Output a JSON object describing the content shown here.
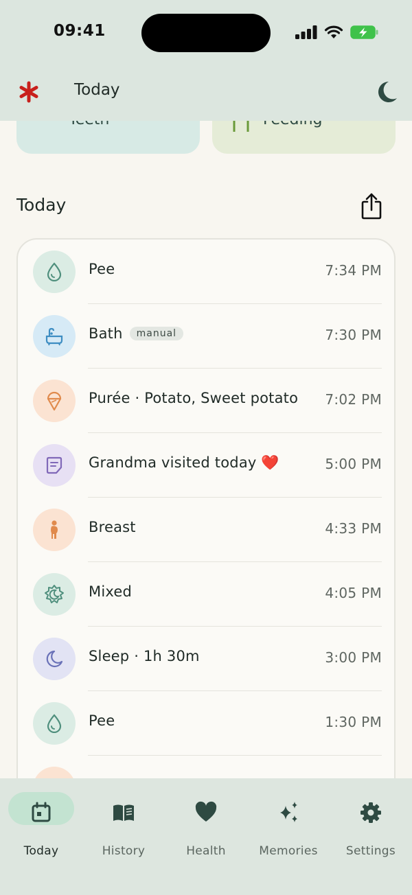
{
  "status_bar": {
    "time": "09:41"
  },
  "header": {
    "title": "Today",
    "logo_icon": "asterisk-icon",
    "theme_icon": "moon-icon"
  },
  "peek_cards": [
    {
      "label": "Teeth",
      "icon": "tooth-icon",
      "color": "#d7eae5"
    },
    {
      "label": "Feeding",
      "icon": "utensils-icon",
      "color": "#e5ecd7"
    }
  ],
  "section": {
    "title": "Today",
    "share_icon": "share-icon"
  },
  "events": [
    {
      "label": "Pee",
      "time": "7:34 PM",
      "icon": "droplet-icon",
      "icon_bg": "#dbece4",
      "icon_color": "#4f8f7d"
    },
    {
      "label": "Bath",
      "badge": "manual",
      "time": "7:30 PM",
      "icon": "bathtub-icon",
      "icon_bg": "#d6eaf6",
      "icon_color": "#3d8dc2"
    },
    {
      "label": "Purée · Potato, Sweet potato",
      "time": "7:02 PM",
      "icon": "ice-cream-icon",
      "icon_bg": "#fbe3d2",
      "icon_color": "#e08a4c"
    },
    {
      "label": "Grandma visited today ❤️",
      "time": "5:00 PM",
      "icon": "note-icon",
      "icon_bg": "#e7e0f4",
      "icon_color": "#8068b8"
    },
    {
      "label": "Breast",
      "time": "4:33 PM",
      "icon": "person-icon",
      "icon_bg": "#fbe3d2",
      "icon_color": "#e08a4c"
    },
    {
      "label": "Mixed",
      "time": "4:05 PM",
      "icon": "sun-moon-icon",
      "icon_bg": "#dbece4",
      "icon_color": "#4f8f7d"
    },
    {
      "label": "Sleep · 1h 30m",
      "time": "3:00 PM",
      "icon": "moon-icon",
      "icon_bg": "#e2e3f4",
      "icon_color": "#6a72b8"
    },
    {
      "label": "Pee",
      "time": "1:30 PM",
      "icon": "droplet-icon",
      "icon_bg": "#dbece4",
      "icon_color": "#4f8f7d"
    }
  ],
  "tabs": [
    {
      "label": "Today",
      "icon": "calendar-icon",
      "active": true
    },
    {
      "label": "History",
      "icon": "book-icon",
      "active": false
    },
    {
      "label": "Health",
      "icon": "heart-icon",
      "active": false
    },
    {
      "label": "Memories",
      "icon": "sparkles-icon",
      "active": false
    },
    {
      "label": "Settings",
      "icon": "gear-icon",
      "active": false
    }
  ],
  "colors": {
    "header_bg": "#dce6df",
    "background": "#f8f6f0",
    "accent": "#c3e3d1",
    "logo": "#c8201c"
  }
}
